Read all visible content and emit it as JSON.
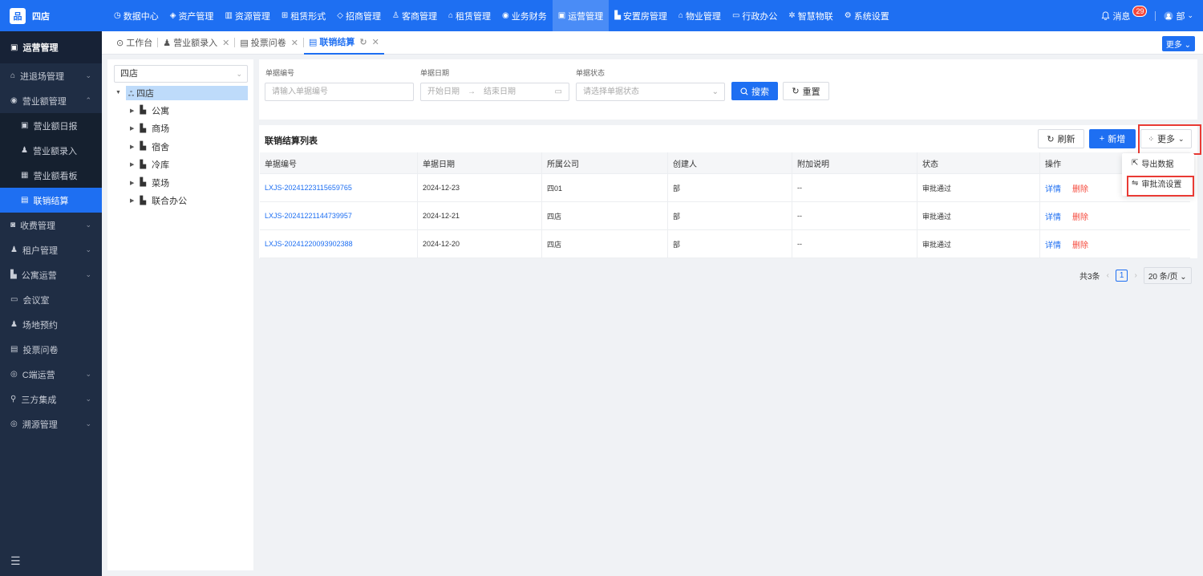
{
  "app": {
    "logo_glyph": "品",
    "store_name": "四店"
  },
  "nav": {
    "items": [
      {
        "label": "数据中心",
        "icon": "clock-icon"
      },
      {
        "label": "资产管理",
        "icon": "cube-icon"
      },
      {
        "label": "资源管理",
        "icon": "chart-icon"
      },
      {
        "label": "租赁形式",
        "icon": "grid-icon"
      },
      {
        "label": "招商管理",
        "icon": "tag-icon"
      },
      {
        "label": "客商管理",
        "icon": "users-icon"
      },
      {
        "label": "租赁管理",
        "icon": "home-icon"
      },
      {
        "label": "业务财务",
        "icon": "money-icon"
      },
      {
        "label": "运营管理",
        "icon": "calendar-icon",
        "active": true
      },
      {
        "label": "安置房管理",
        "icon": "building-icon"
      },
      {
        "label": "物业管理",
        "icon": "house-icon"
      },
      {
        "label": "行政办公",
        "icon": "monitor-icon"
      },
      {
        "label": "智慧物联",
        "icon": "network-icon"
      },
      {
        "label": "系统设置",
        "icon": "gear-icon"
      }
    ],
    "messages_label": "消息",
    "messages_count": "29",
    "user_label": "部"
  },
  "sidebar": {
    "header": "运营管理",
    "items": [
      {
        "label": "进退场管理",
        "icon": "home-icon",
        "chevron": "⌄"
      },
      {
        "label": "营业额管理",
        "icon": "money-icon",
        "chevron": "⌃"
      },
      {
        "label": "营业额日报",
        "icon": "calendar-icon",
        "sub": true
      },
      {
        "label": "营业额录入",
        "icon": "person-icon",
        "sub": true
      },
      {
        "label": "营业额看板",
        "icon": "board-icon",
        "sub": true
      },
      {
        "label": "联销结算",
        "icon": "doc-icon",
        "sub": true,
        "active": true
      },
      {
        "label": "收费管理",
        "icon": "wallet-icon",
        "chevron": "⌄"
      },
      {
        "label": "租户管理",
        "icon": "person-icon",
        "chevron": "⌄"
      },
      {
        "label": "公寓运营",
        "icon": "building-icon",
        "chevron": "⌄"
      },
      {
        "label": "会议室",
        "icon": "monitor-icon"
      },
      {
        "label": "场地预约",
        "icon": "person-icon"
      },
      {
        "label": "投票问卷",
        "icon": "doc-icon"
      },
      {
        "label": "C端运营",
        "icon": "target-icon",
        "chevron": "⌄"
      },
      {
        "label": "三方集成",
        "icon": "link-icon",
        "chevron": "⌄"
      },
      {
        "label": "溯源管理",
        "icon": "radar-icon",
        "chevron": "⌄"
      }
    ],
    "collapse_icon": "☰"
  },
  "tabs": {
    "items": [
      {
        "label": "工作台",
        "icon": "⊙",
        "closable": false
      },
      {
        "label": "营业额录入",
        "icon": "♟",
        "closable": true
      },
      {
        "label": "投票问卷",
        "icon": "▤",
        "closable": true
      },
      {
        "label": "联销结算",
        "icon": "▤",
        "closable": true,
        "active": true
      }
    ],
    "more_label": "更多"
  },
  "tree": {
    "select_value": "四店",
    "root": "四店",
    "nodes": [
      "公寓",
      "商场",
      "宿舍",
      "冷库",
      "菜场",
      "联合办公"
    ]
  },
  "search": {
    "doc_no_label": "单据编号",
    "doc_no_placeholder": "请输入单据编号",
    "date_label": "单据日期",
    "date_start_placeholder": "开始日期",
    "date_end_placeholder": "结束日期",
    "status_label": "单据状态",
    "status_placeholder": "请选择单据状态",
    "search_btn": "搜索",
    "reset_btn": "重置"
  },
  "list": {
    "title": "联销结算列表",
    "refresh_btn": "刷新",
    "add_btn": "新增",
    "more_btn": "更多",
    "columns": [
      "单据编号",
      "单据日期",
      "所属公司",
      "创建人",
      "附加说明",
      "状态",
      "操作"
    ],
    "rows": [
      {
        "no": "LXJS-20241223115659765",
        "date": "2024-12-23",
        "company": "四01",
        "creator": "部",
        "note": "--",
        "status": "审批通过"
      },
      {
        "no": "LXJS-20241221144739957",
        "date": "2024-12-21",
        "company": "四店",
        "creator": "部",
        "note": "--",
        "status": "审批通过"
      },
      {
        "no": "LXJS-20241220093902388",
        "date": "2024-12-20",
        "company": "四店",
        "creator": "部",
        "note": "--",
        "status": "审批通过"
      }
    ],
    "op_detail": "详情",
    "op_delete": "删除"
  },
  "more_menu": {
    "export": "导出数据",
    "approval": "审批流设置"
  },
  "pagination": {
    "total": "共3条",
    "page": "1",
    "page_size": "20 条/页"
  },
  "colors": {
    "primary": "#1e6ff2",
    "sidebar_bg": "#1f2d44",
    "danger": "#f5483b",
    "highlight": "#e93a34"
  }
}
